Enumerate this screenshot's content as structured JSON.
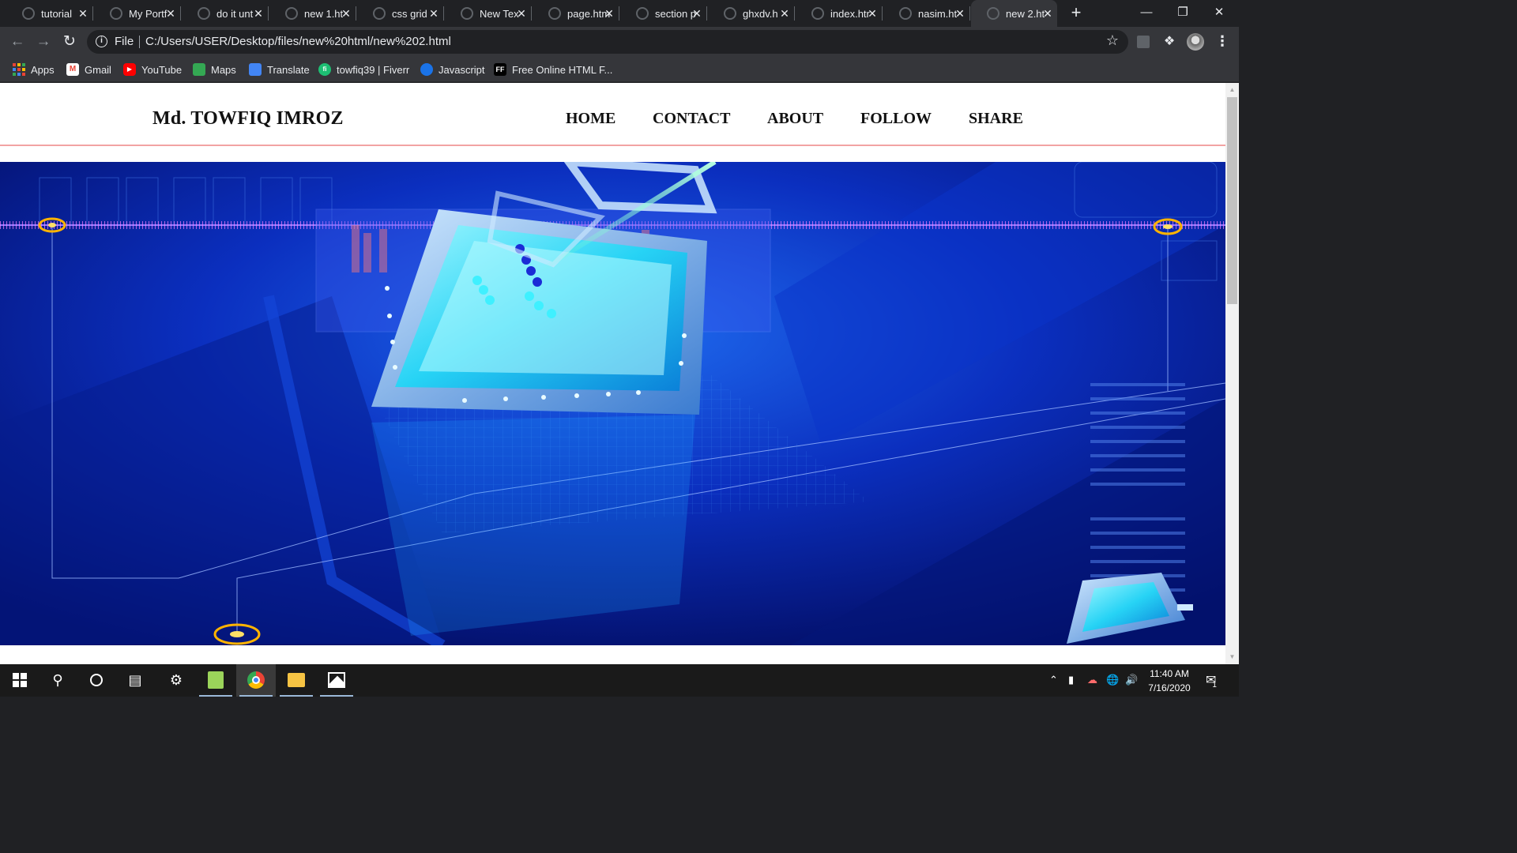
{
  "browser": {
    "tabs": [
      {
        "title": "tutorial",
        "active": false
      },
      {
        "title": "My Portf",
        "active": false
      },
      {
        "title": "do it unt",
        "active": false
      },
      {
        "title": "new 1.ht",
        "active": false
      },
      {
        "title": "css grid",
        "active": false
      },
      {
        "title": "New Tex",
        "active": false
      },
      {
        "title": "page.htm",
        "active": false
      },
      {
        "title": "section p",
        "active": false
      },
      {
        "title": "ghxdv.h",
        "active": false
      },
      {
        "title": "index.htr",
        "active": false
      },
      {
        "title": "nasim.ht",
        "active": false
      },
      {
        "title": "new 2.ht",
        "active": true
      }
    ],
    "new_tab_icon": "plus-icon",
    "address": {
      "scheme_label": "File",
      "url": "C:/Users/USER/Desktop/files/new%20html/new%202.html"
    },
    "bookmarks": [
      {
        "label": "Apps",
        "icon": "apps-grid-icon"
      },
      {
        "label": "Gmail",
        "icon": "gmail-icon",
        "color": "#ea4335"
      },
      {
        "label": "YouTube",
        "icon": "youtube-icon",
        "color": "#ff0000"
      },
      {
        "label": "Maps",
        "icon": "maps-icon",
        "color": "#34a853"
      },
      {
        "label": "Translate",
        "icon": "translate-icon",
        "color": "#4285f4"
      },
      {
        "label": "towfiq39 | Fiverr",
        "icon": "fiverr-icon",
        "color": "#1dbf73"
      },
      {
        "label": "Javascript",
        "icon": "javascript-icon",
        "color": "#1a73e8"
      },
      {
        "label": "Free Online HTML F...",
        "icon": "ff-icon",
        "color": "#000000"
      }
    ]
  },
  "site": {
    "logo": "Md. TOWFIQ IMROZ",
    "nav": [
      "HOME",
      "CONTACT",
      "ABOUT",
      "FOLLOW",
      "SHARE"
    ],
    "header_border_color": "#f2a3a3",
    "hero": {
      "description_icon": "tech-hero-image",
      "accent": "#0a2cc8"
    }
  },
  "taskbar": {
    "items": [
      "windows-start-icon",
      "search-icon",
      "cortana-icon",
      "task-view-icon",
      "settings-icon",
      "notepad-plus-icon",
      "chrome-icon",
      "file-explorer-icon",
      "photos-icon"
    ],
    "time": "11:40 AM",
    "date": "7/16/2020",
    "notification_count": "1"
  }
}
